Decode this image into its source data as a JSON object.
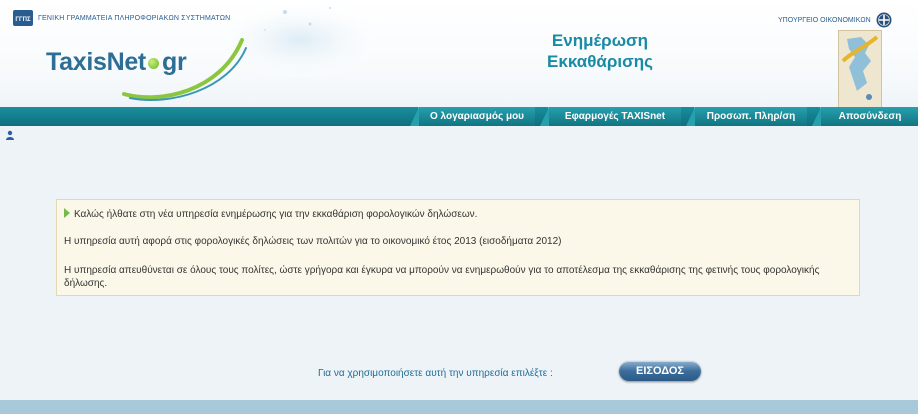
{
  "header": {
    "org_name": "ΓΕΝΙΚΗ ΓΡΑΜΜΑΤΕΙΑ ΠΛΗΡΟΦΟΡΙΑΚΩΝ ΣΥΣΤΗΜΑΤΩΝ",
    "org_logo_mark": "ΓΓΠΣ",
    "logo_text": "TaxisNet",
    "logo_suffix": "gr",
    "app_title_line1": "Ενημέρωση",
    "app_title_line2": "Εκκαθάρισης",
    "ministry": "ΥΠΟΥΡΓΕΙΟ ΟΙΚΟΝΟΜΙΚΩΝ"
  },
  "nav": {
    "tabs": [
      {
        "label": "Ο λογαριασμός μου"
      },
      {
        "label": "Εφαρμογές TAXISnet"
      },
      {
        "label": "Προσωπ. Πληρ/ση"
      },
      {
        "label": "Αποσύνδεση"
      }
    ]
  },
  "info": {
    "welcome": "Καλώς ήλθατε στη νέα υπηρεσία ενημέρωσης για την εκκαθάριση φορολογικών δηλώσεων.",
    "scope": "Η υπηρεσία αυτή αφορά στις φορολογικές δηλώσεις των πολιτών για το οικονομικό έτος 2013 (εισοδήματα 2012)",
    "audience": "Η υπηρεσία απευθύνεται σε όλους τους πολίτες, ώστε γρήγορα και έγκυρα να μπορούν να ενημερωθούν για το αποτέλεσμα της εκκαθάρισης της φετινής τους φορολογικής δήλωσης."
  },
  "enter": {
    "prompt": "Για να χρησιμοποιήσετε αυτή την υπηρεσία επιλέξτε :",
    "button_label": "ΕΙΣΟΔΟΣ"
  },
  "icons": {
    "user": "user-icon",
    "arrow": "arrow-right-icon"
  },
  "colors": {
    "nav_bg": "#0e6f7e",
    "title": "#1a8aa5",
    "info_bg": "#fbf8e9",
    "button": "#2b5a86"
  }
}
